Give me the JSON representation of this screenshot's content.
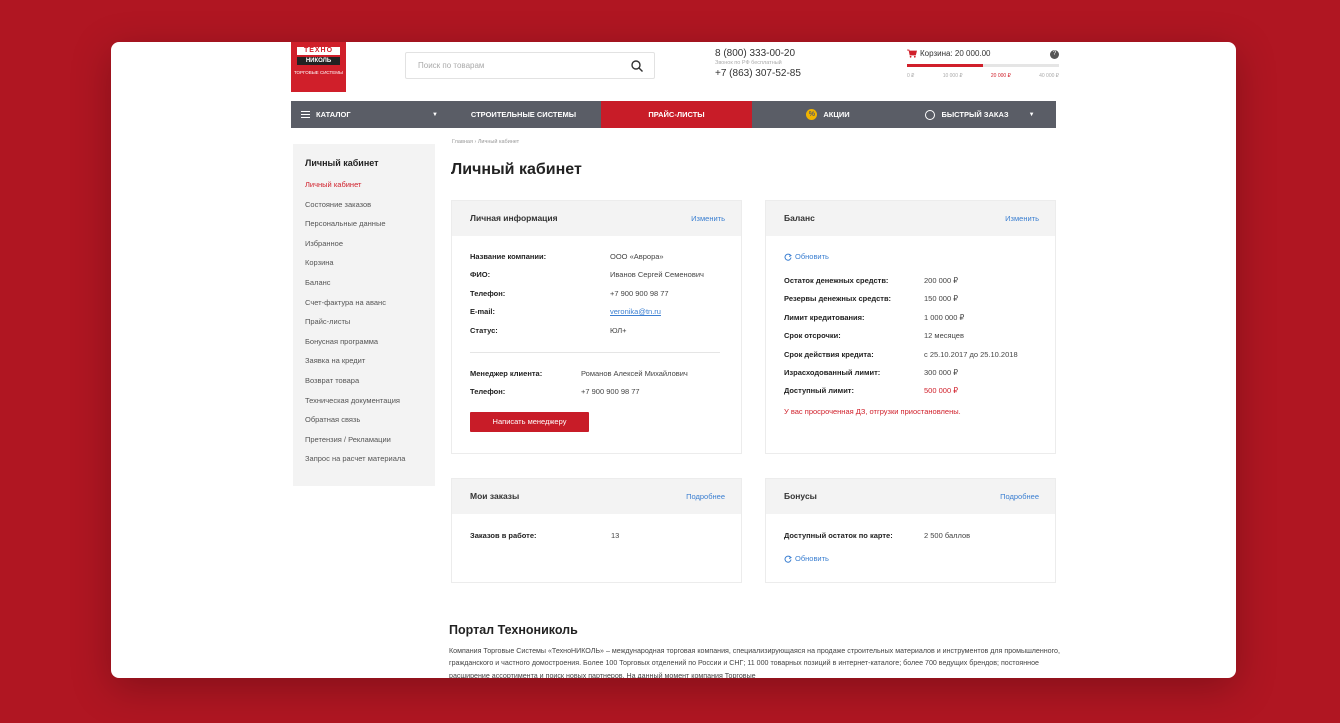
{
  "header": {
    "logo": {
      "line1": "ТЕХНО",
      "line2": "НИКОЛЬ",
      "line3": "ТОРГОВЫЕ СИСТЕМЫ"
    },
    "search_placeholder": "Поиск по товарам",
    "phone1": "8 (800) 333-00-20",
    "phone1_note": "Звонок по РФ бесплатный",
    "phone2": "+7 (863) 307-52-85",
    "cart": {
      "title": "Корзина: 20 000.00",
      "progress_fraction": 0.5,
      "ticks": [
        "0 ₽",
        "10 000 ₽",
        "20 000 ₽",
        "40 000 ₽"
      ],
      "active_tick": 2,
      "help": "?"
    }
  },
  "nav": {
    "catalog": "Каталог",
    "catalog_caret": "▼",
    "build": "Строительные системы",
    "price": "Прайс-листы",
    "promo": "Акции",
    "promo_badge": "%",
    "fast": "Быстрый заказ",
    "fast_caret": "▼"
  },
  "sidebar": {
    "title": "Личный кабинет",
    "items": [
      "Личный кабинет",
      "Состояние заказов",
      "Персональные данные",
      "Избранное",
      "Корзина",
      "Баланс",
      "Счет-фактура на аванс",
      "Прайс-листы",
      "Бонусная программа",
      "Заявка на кредит",
      "Возврат товара",
      "Техническая документация",
      "Обратная связь",
      "Претензия / Рекламации",
      "Запрос на расчет материала"
    ]
  },
  "breadcrumb": "Главная › Личный кабинет",
  "page_title": "Личный кабинет",
  "personal": {
    "title": "Личная информация",
    "edit": "Изменить",
    "rows": [
      {
        "k": "Название компании:",
        "v": "ООО «Аврора»"
      },
      {
        "k": "ФИО:",
        "v": "Иванов Сергей Семенович"
      },
      {
        "k": "Телефон:",
        "v": "+7 900 900 98 77"
      },
      {
        "k": "E-mail:",
        "v": "veronika@tn.ru"
      },
      {
        "k": "Статус:",
        "v": "ЮЛ+"
      }
    ],
    "manager_label": "Менеджер клиента:",
    "manager_name": "Романов Алексей Михайлович",
    "manager_phone_label": "Телефон:",
    "manager_phone": "+7 900 900 98 77",
    "button": "Написать менеджеру"
  },
  "balance": {
    "title": "Баланс",
    "edit": "Изменить",
    "refresh": "Обновить",
    "rows": [
      {
        "k": "Остаток денежных средств:",
        "v": "200 000 ₽"
      },
      {
        "k": "Резервы денежных средств:",
        "v": "150 000 ₽"
      },
      {
        "k": "Лимит кредитования:",
        "v": "1 000 000 ₽"
      },
      {
        "k": "Срок отсрочки:",
        "v": "12 месяцев"
      },
      {
        "k": "Срок действия кредита:",
        "v": "с 25.10.2017 до 25.10.2018"
      },
      {
        "k": "Израсходованный лимит:",
        "v": "300 000 ₽"
      },
      {
        "k": "Доступный лимит:",
        "v": "500 000 ₽"
      }
    ],
    "warning": "У вас просроченная ДЗ, отгрузки приостановлены."
  },
  "orders": {
    "title": "Мои заказы",
    "more": "Подробнее",
    "label": "Заказов в работе:",
    "value": "13"
  },
  "bonuses": {
    "title": "Бонусы",
    "more": "Подробнее",
    "label": "Доступный остаток по карте:",
    "value": "2 500 баллов",
    "refresh": "Обновить"
  },
  "portal": {
    "title": "Портал Технониколь",
    "text": "Компания Торговые Системы «ТехноНИКОЛЬ» – международная торговая компания, специализирующаяся на продаже строительных материалов и инструментов для промышленного, гражданского и частного домостроения. Более 100 Торговых отделений по России и СНГ; 11 000 товарных позиций в интернет-каталоге; более 700 ведущих брендов; постоянное расширение ассортимента и поиск новых партнеров. На данный момент компания Торговые"
  },
  "colors": {
    "brand_red": "#c81c28",
    "page_bg": "#b01622",
    "nav_bg": "#5a5d66",
    "link_blue": "#3b7fd1"
  }
}
